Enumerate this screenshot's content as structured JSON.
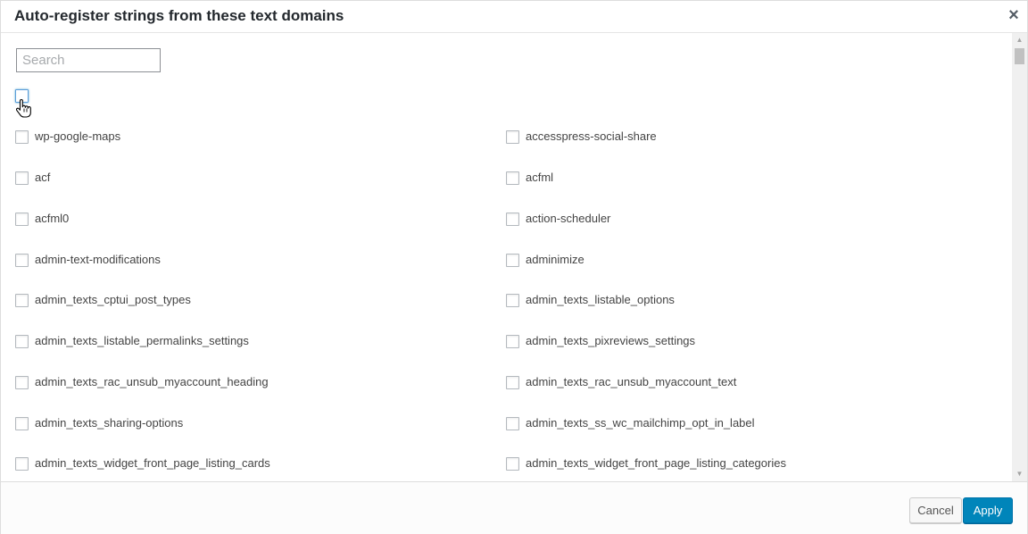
{
  "dialog": {
    "title": "Auto-register strings from these text domains",
    "close_glyph": "×"
  },
  "search": {
    "placeholder": "Search",
    "value": ""
  },
  "domains": {
    "left": [
      "wp-google-maps",
      "acf",
      "acfml0",
      "admin-text-modifications",
      "admin_texts_cptui_post_types",
      "admin_texts_listable_permalinks_settings",
      "admin_texts_rac_unsub_myaccount_heading",
      "admin_texts_sharing-options",
      "admin_texts_widget_front_page_listing_cards"
    ],
    "right": [
      "accesspress-social-share",
      "acfml",
      "action-scheduler",
      "adminimize",
      "admin_texts_listable_options",
      "admin_texts_pixreviews_settings",
      "admin_texts_rac_unsub_myaccount_text",
      "admin_texts_ss_wc_mailchimp_opt_in_label",
      "admin_texts_widget_front_page_listing_categories"
    ]
  },
  "footer": {
    "cancel_label": "Cancel",
    "apply_label": "Apply"
  },
  "colors": {
    "accent": "#0085ba",
    "focus": "#5b9dd9"
  },
  "icons": {
    "close": "close-icon",
    "cursor": "hand-pointer-icon"
  }
}
